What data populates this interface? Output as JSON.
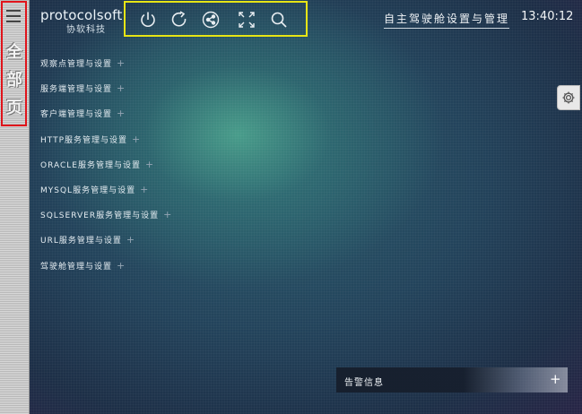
{
  "left_rail": {
    "menu_icon": "hamburger-icon",
    "vertical_label": [
      "全",
      "部",
      "页"
    ]
  },
  "logo": {
    "text": "protocolsoft",
    "subtitle": "协软科技"
  },
  "toolbar": {
    "icons": [
      "power-icon",
      "refresh-icon",
      "share-icon",
      "fullscreen-icon",
      "search-icon"
    ]
  },
  "header": {
    "title": "自主驾驶舱设置与管理",
    "clock": "13:40:12"
  },
  "menu": {
    "items": [
      {
        "label": "观察点管理与设置",
        "plus": "+"
      },
      {
        "label": "服务端管理与设置",
        "plus": "+"
      },
      {
        "label": "客户端管理与设置",
        "plus": "+"
      },
      {
        "label": "HTTP服务管理与设置",
        "plus": "+"
      },
      {
        "label": "ORACLE服务管理与设置",
        "plus": "+"
      },
      {
        "label": "MYSQL服务管理与设置",
        "plus": "+"
      },
      {
        "label": "SQLSERVER服务管理与设置",
        "plus": "+"
      },
      {
        "label": "URL服务管理与设置",
        "plus": "+"
      },
      {
        "label": "驾驶舱管理与设置",
        "plus": "+"
      }
    ]
  },
  "settings_button": {
    "icon": "gear-icon"
  },
  "alert_panel": {
    "title": "告警信息",
    "plus": "+"
  }
}
